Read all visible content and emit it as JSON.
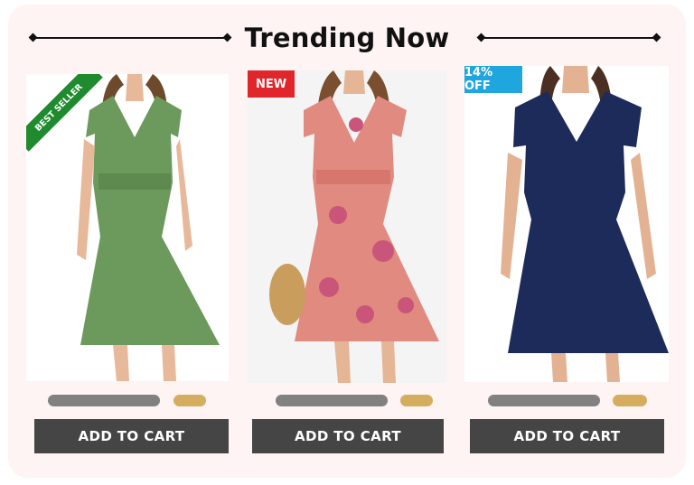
{
  "header": {
    "title": "Trending Now"
  },
  "products": [
    {
      "badge": "BEST SELLER",
      "badge_color": "#1f8a2e",
      "dress_color": "#6b9a5c",
      "cart_label": "ADD TO CART"
    },
    {
      "badge": "NEW",
      "badge_color": "#e0262b",
      "dress_color": "#e08a80",
      "cart_label": "ADD TO CART"
    },
    {
      "badge": "14% OFF",
      "badge_color": "#1fa6de",
      "dress_color": "#1c2b5a",
      "cart_label": "ADD TO CART"
    }
  ],
  "colors": {
    "background": "#fdf4f3",
    "button": "#454545",
    "name_placeholder": "#818181",
    "price_placeholder": "#d5ad5f"
  }
}
